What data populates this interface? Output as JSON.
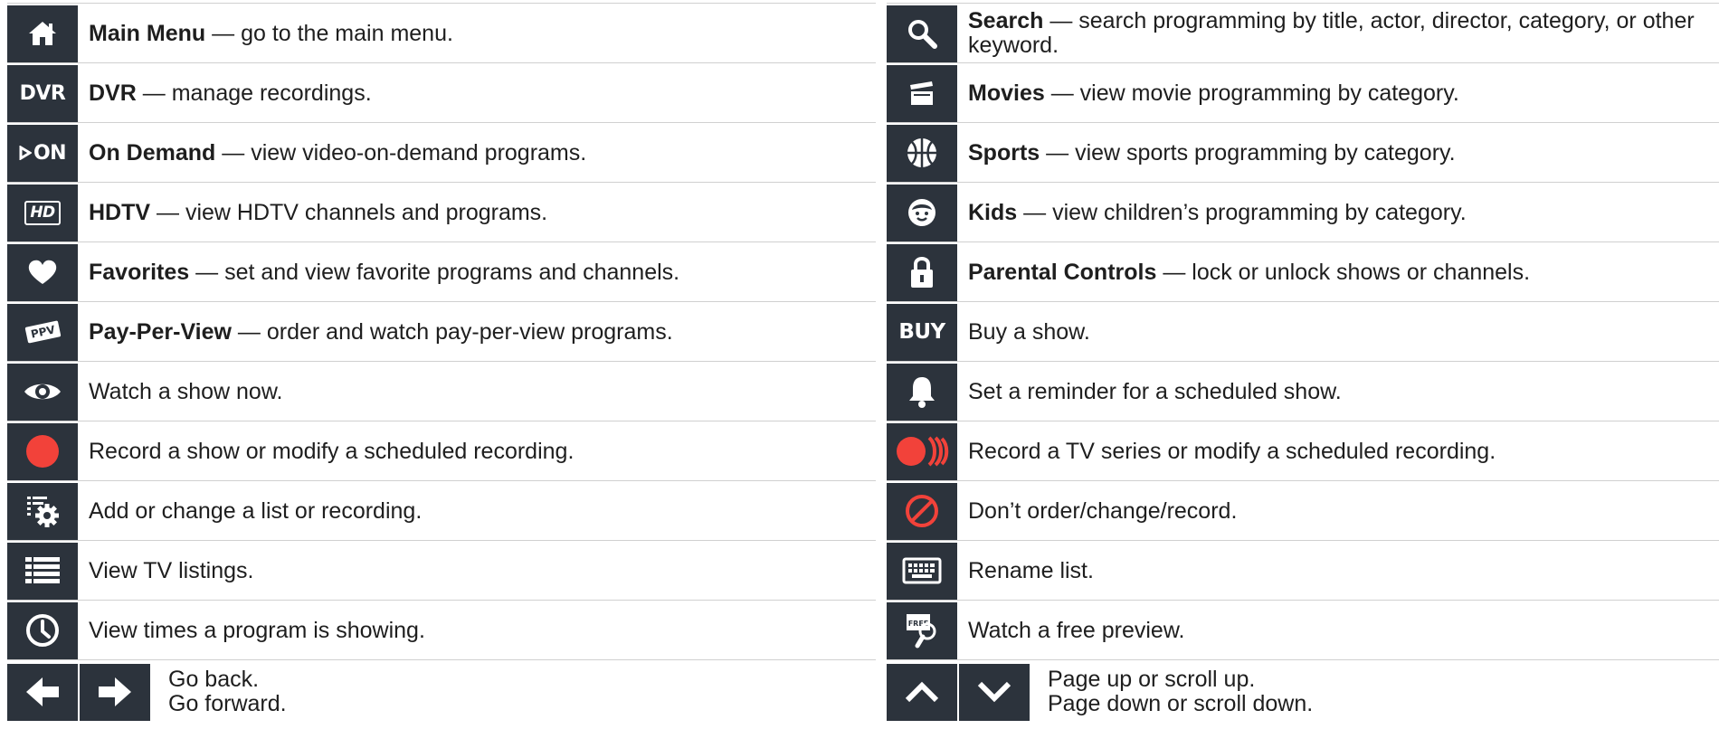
{
  "left": [
    {
      "icon": "home-icon",
      "title": "Main Menu",
      "text": " — go to the main menu."
    },
    {
      "icon": "dvr-icon",
      "glyph": "DVR",
      "title": "DVR",
      "text": " — manage recordings."
    },
    {
      "icon": "on-demand-icon",
      "glyph": "ON",
      "title": "On Demand",
      "text": " — view video-on-demand programs."
    },
    {
      "icon": "hd-icon",
      "glyph": "HD",
      "title": "HDTV",
      "text": " — view HDTV channels and programs."
    },
    {
      "icon": "heart-icon",
      "title": "Favorites",
      "text": " — set and view favorite programs and channels."
    },
    {
      "icon": "ppv-ticket-icon",
      "glyph": "PPV",
      "title": "Pay-Per-View",
      "text": " — order and watch pay-per-view programs."
    },
    {
      "icon": "eye-icon",
      "title": "",
      "text": "Watch  a show now."
    },
    {
      "icon": "record-icon",
      "title": "",
      "text": "Record a show or modify a scheduled recording."
    },
    {
      "icon": "list-settings-icon",
      "title": "",
      "text": "Add or change a list or recording."
    },
    {
      "icon": "listings-icon",
      "title": "",
      "text": "View TV listings."
    },
    {
      "icon": "clock-icon",
      "title": "",
      "text": "View times a program is showing."
    }
  ],
  "right": [
    {
      "icon": "search-icon",
      "title": "Search",
      "text": " — search programming by title, actor, director, category, or other",
      "text2": "keyword."
    },
    {
      "icon": "movies-clapper-icon",
      "title": "Movies",
      "text": " — view movie programming by category."
    },
    {
      "icon": "sports-ball-icon",
      "title": "Sports",
      "text": " — view sports programming by category."
    },
    {
      "icon": "kids-face-icon",
      "title": "Kids",
      "text": " — view children’s programming by category."
    },
    {
      "icon": "lock-icon",
      "title": "Parental Controls",
      "text": " — lock or unlock shows or channels."
    },
    {
      "icon": "buy-icon",
      "glyph": "BUY",
      "title": "",
      "text": "Buy a show."
    },
    {
      "icon": "bell-icon",
      "title": "",
      "text": "Set a reminder for a scheduled show."
    },
    {
      "icon": "series-record-icon",
      "title": "",
      "text": "Record a TV series or modify a scheduled recording."
    },
    {
      "icon": "cancel-icon",
      "title": "",
      "text": "Don’t order/change/record."
    },
    {
      "icon": "keyboard-icon",
      "title": "",
      "text": "Rename list."
    },
    {
      "icon": "free-preview-icon",
      "glyph": "FREE",
      "title": "",
      "text": "Watch a free preview."
    }
  ],
  "nav_left": {
    "line1": "Go back.",
    "line2": "Go forward."
  },
  "nav_right": {
    "line1": "Page up or scroll up.",
    "line2": "Page down or scroll down."
  },
  "colors": {
    "icon_bg": "#2c333c",
    "record_red": "#f2423a",
    "divider": "#d0d0d0"
  }
}
